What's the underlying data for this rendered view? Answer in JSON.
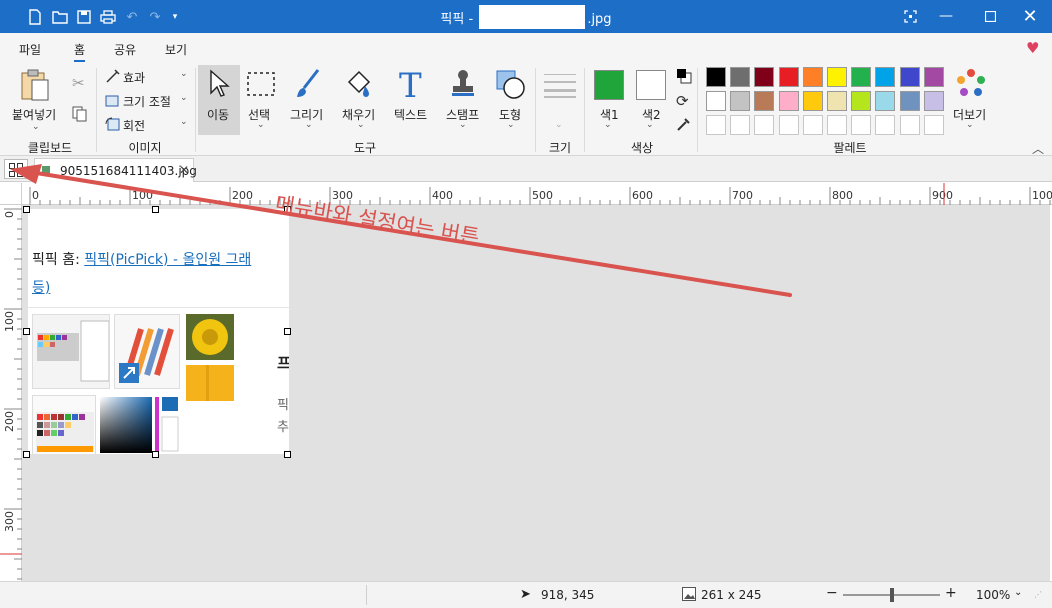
{
  "window": {
    "title_prefix": "픽픽 - ",
    "title_suffix": ".jpg"
  },
  "menu": {
    "tabs": [
      "파일",
      "홈",
      "공유",
      "보기"
    ],
    "active_tab": "홈"
  },
  "ribbon": {
    "clipboard": {
      "paste": "붙여넣기",
      "group": "클립보드"
    },
    "image": {
      "effect": "효과",
      "resize": "크기 조절",
      "rotate": "회전",
      "group": "이미지"
    },
    "tools": {
      "move": "이동",
      "select": "선택",
      "draw": "그리기",
      "fill": "채우기",
      "text": "텍스트",
      "stamp": "스탬프",
      "shape": "도형",
      "group": "도구"
    },
    "size": {
      "group": "크기"
    },
    "color": {
      "color1": "색1",
      "color2": "색2",
      "group": "색상",
      "color1_value": "#1fa53a",
      "color2_value": "#ffffff"
    },
    "palette": {
      "group": "팔레트",
      "more": "더보기",
      "row1": [
        "#000000",
        "#6e6e6e",
        "#7f0018",
        "#e81e25",
        "#ff7f27",
        "#fff200",
        "#22b14c",
        "#00a2e8",
        "#3f48cc",
        "#a349a4"
      ],
      "row2": [
        "#ffffff",
        "#c3c3c3",
        "#b97a57",
        "#ffaec9",
        "#ffc90e",
        "#efe4b0",
        "#b5e61d",
        "#99d9ea",
        "#7092be",
        "#c8bfe7"
      ]
    }
  },
  "document": {
    "tab_name": "905151684111403.jpg"
  },
  "ruler": {
    "h_ticks": [
      "0",
      "100",
      "200",
      "300",
      "400",
      "500",
      "600",
      "700",
      "800",
      "900",
      "1000"
    ],
    "v_ticks": [
      "0",
      "100",
      "200",
      "300"
    ]
  },
  "canvas": {
    "content_line1_prefix": "픽픽 홈: ",
    "content_line1_link": "픽픽(PicPick) - 올인원 그래",
    "content_line2": "등)",
    "side_text_1": "픽",
    "side_text_2": "추",
    "side_heading": "프"
  },
  "annotation": {
    "text": "메뉴바와 설정여는 버튼",
    "color": "#d9534f"
  },
  "status": {
    "cursor_pos": "918, 345",
    "image_size": "261 x 245",
    "zoom": "100%",
    "zoom_level": 0.5
  }
}
